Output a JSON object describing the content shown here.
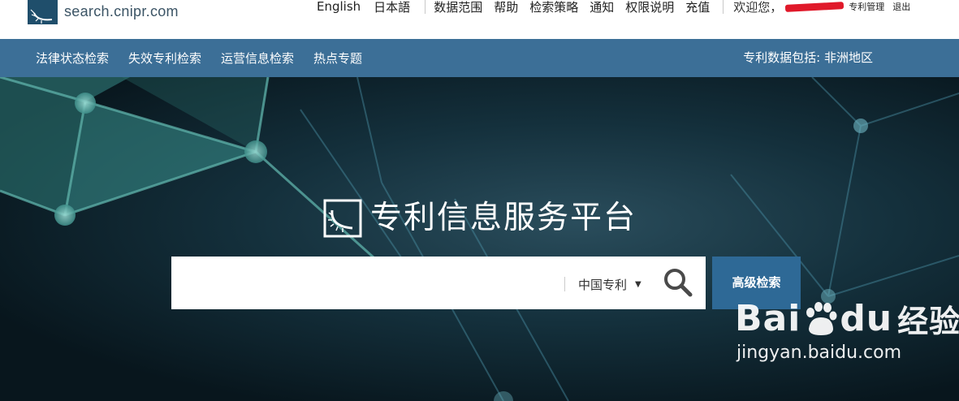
{
  "header": {
    "logo_text": "search.cnipr.com",
    "lang_english": "English",
    "lang_japanese": "日本語",
    "nav": [
      "数据范围",
      "帮助",
      "检索策略",
      "通知",
      "权限说明",
      "充值"
    ],
    "welcome": "欢迎您，",
    "patent_manage": "专利管理",
    "logout": "退出"
  },
  "menu": {
    "items": [
      "法律状态检索",
      "失效专利检索",
      "运营信息检索",
      "热点专题"
    ],
    "coverage": "专利数据包括: 非洲地区"
  },
  "hero": {
    "title": "专利信息服务平台",
    "search": {
      "value": "",
      "placeholder": "",
      "scope": "中国专利"
    },
    "advanced_label": "高级检索"
  },
  "watermark": {
    "brand": "Bai",
    "brand2": "du",
    "cn": "经验",
    "url": "jingyan.baidu.com"
  },
  "colors": {
    "menubar": "#3c6f97",
    "advanced_button": "#2e6996",
    "logo": "#1f4e6b"
  }
}
